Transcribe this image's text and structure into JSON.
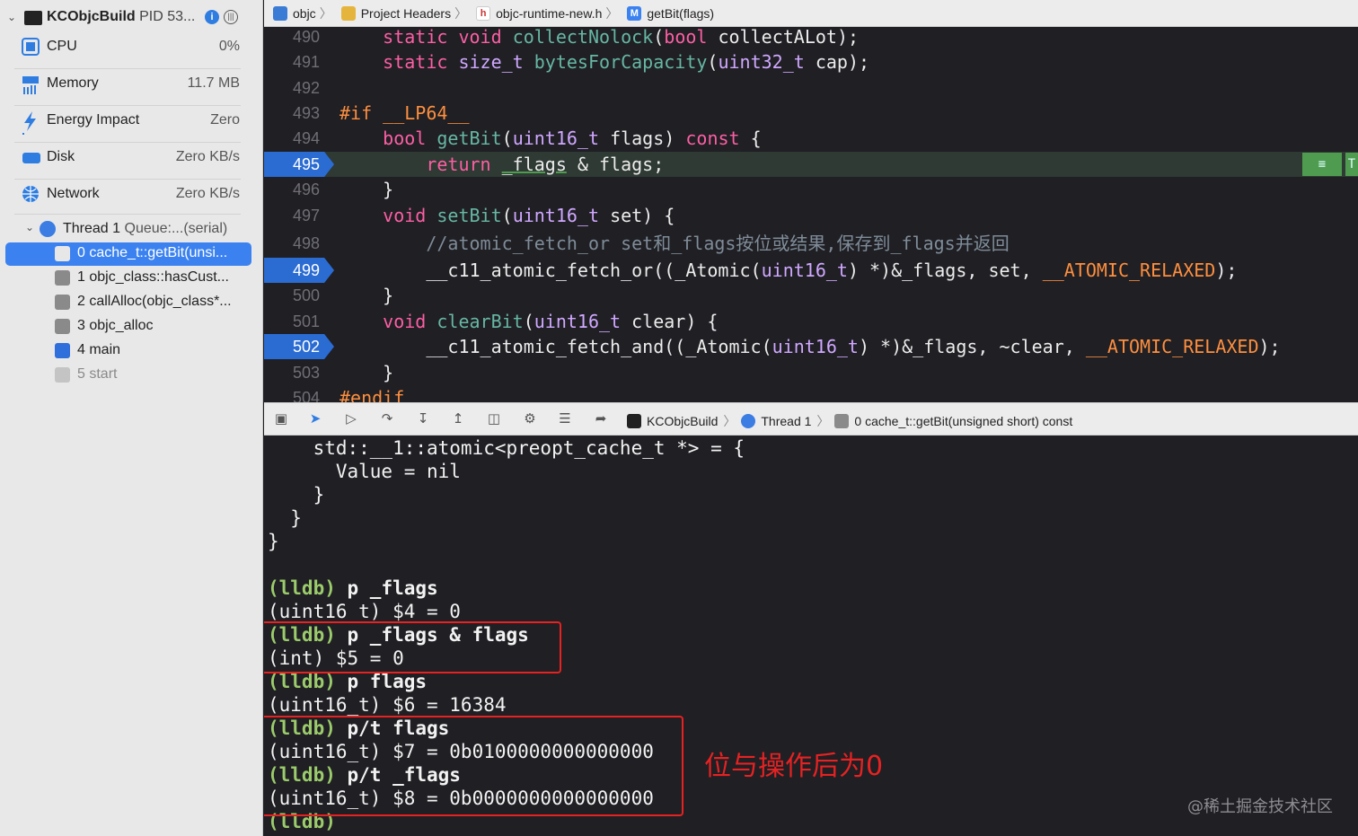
{
  "colors": {
    "accent": "#3b82f0",
    "breakpoint": "#2b6cd3",
    "prompt": "#9bcb6b",
    "annotation": "#e62222",
    "keyword": "#fc5fa3",
    "type": "#d0a8ff",
    "function": "#67b7a4",
    "macro": "#fd8f3f",
    "comment": "#7f8c98"
  },
  "sidebar": {
    "process": {
      "name": "KCObjcBuild",
      "pid": "PID 53..."
    },
    "gauges": [
      {
        "icon": "cpu-icon",
        "label": "CPU",
        "value": "0%"
      },
      {
        "icon": "memory-icon",
        "label": "Memory",
        "value": "11.7 MB"
      },
      {
        "icon": "energy-icon",
        "label": "Energy Impact",
        "value": "Zero"
      },
      {
        "icon": "disk-icon",
        "label": "Disk",
        "value": "Zero KB/s"
      },
      {
        "icon": "network-icon",
        "label": "Network",
        "value": "Zero KB/s"
      }
    ],
    "thread": {
      "label": "Thread 1",
      "queue": "Queue:...(serial)"
    },
    "frames": [
      {
        "label": "0 cache_t::getBit(unsi..."
      },
      {
        "label": "1 objc_class::hasCust..."
      },
      {
        "label": "2 callAlloc(objc_class*..."
      },
      {
        "label": "3 objc_alloc"
      },
      {
        "label": "4 main"
      },
      {
        "label": "5 start"
      }
    ]
  },
  "jumpbar": {
    "items": [
      "objc",
      "Project Headers",
      "objc-runtime-new.h",
      "getBit(flags)"
    ]
  },
  "editor": {
    "lines": [
      {
        "n": "490"
      },
      {
        "n": "491"
      },
      {
        "n": "492"
      },
      {
        "n": "493"
      },
      {
        "n": "494"
      },
      {
        "n": "495"
      },
      {
        "n": "496"
      },
      {
        "n": "497"
      },
      {
        "n": "498"
      },
      {
        "n": "499"
      },
      {
        "n": "500"
      },
      {
        "n": "501"
      },
      {
        "n": "502"
      },
      {
        "n": "503"
      },
      {
        "n": "504"
      }
    ],
    "code": {
      "l490": {
        "a": "static",
        "b": "void",
        "c": "collectNolock",
        "d": "bool",
        "e": "collectALot);"
      },
      "l491": {
        "a": "static",
        "b": "size_t",
        "c": "bytesForCapacity",
        "d": "uint32_t",
        "e": "cap);"
      },
      "l493": {
        "a": "#if",
        "b": "__LP64__"
      },
      "l494": {
        "a": "bool",
        "b": "getBit",
        "c": "uint16_t",
        "d": "flags)",
        "e": "const",
        "f": "{"
      },
      "l495": {
        "a": "return",
        "b": "_flags",
        "c": "& flags;"
      },
      "l496": {
        "a": "}"
      },
      "l497": {
        "a": "void",
        "b": "setBit",
        "c": "uint16_t",
        "d": "set) {"
      },
      "l498": {
        "a": "//atomic_fetch_or set和_flags按位或结果,保存到_flags并返回"
      },
      "l499": {
        "a": "__c11_atomic_fetch_or((_Atomic(",
        "b": "uint16_t",
        "c": ") *)&_flags, set, ",
        "d": "__ATOMIC_RELAXED",
        "e": ");"
      },
      "l500": {
        "a": "}"
      },
      "l501": {
        "a": "void",
        "b": "clearBit",
        "c": "uint16_t",
        "d": "clear) {"
      },
      "l502": {
        "a": "__c11_atomic_fetch_and((_Atomic(",
        "b": "uint16_t",
        "c": ") *)&_flags, ~clear, ",
        "d": "__ATOMIC_RELAXED",
        "e": ");"
      },
      "l503": {
        "a": "}"
      },
      "l504": {
        "a": "#endif"
      }
    },
    "annotation_glyph": "≡",
    "annotation_tail": "T"
  },
  "debugbar": {
    "crumbs": [
      "KCObjcBuild",
      "Thread 1",
      "0 cache_t::getBit(unsigned short) const"
    ]
  },
  "console": {
    "lines": [
      "    std::__1::atomic<preopt_cache_t *> = {",
      "      Value = nil",
      "    }",
      "  }",
      "}"
    ],
    "prompt": "(lldb)",
    "cmds": [
      "p _flags",
      "p _flags & flags",
      "p flags",
      "p/t flags",
      "p/t _flags"
    ],
    "results": [
      "(uint16_t) $4 = 0",
      "(int) $5 = 0",
      "(uint16_t) $6 = 16384",
      "(uint16_t) $7 = 0b0100000000000000",
      "(uint16_t) $8 = 0b0000000000000000"
    ],
    "note": "位与操作后为0",
    "watermark": "@稀土掘金技术社区"
  }
}
